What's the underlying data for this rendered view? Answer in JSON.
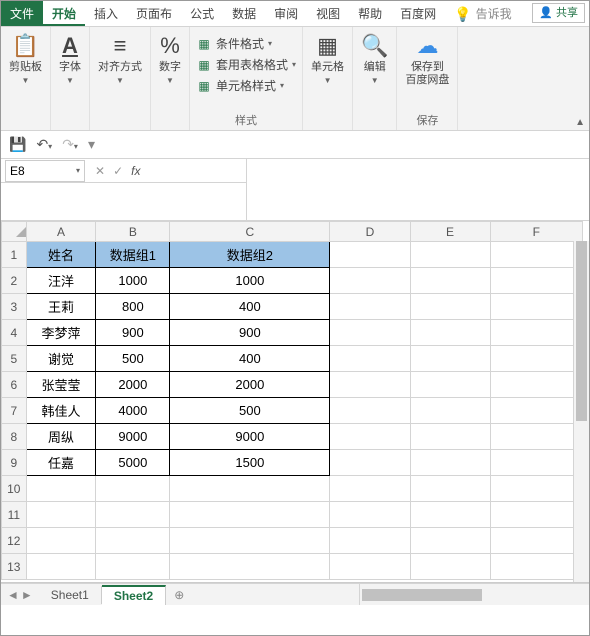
{
  "tabs": {
    "file": "文件",
    "home": "开始",
    "insert": "插入",
    "layout": "页面布",
    "formulas": "公式",
    "data": "数据",
    "review": "审阅",
    "view": "视图",
    "help": "帮助",
    "baidu": "百度网",
    "tell": "告诉我",
    "share": "共享"
  },
  "ribbon": {
    "clipboard": "剪贴板",
    "font": "字体",
    "align": "对齐方式",
    "number": "数字",
    "cond_fmt": "条件格式",
    "table_fmt": "套用表格格式",
    "cell_style": "单元格样式",
    "styles": "样式",
    "cells": "单元格",
    "editing": "编辑",
    "save_baidu": "保存到\n百度网盘",
    "save": "保存"
  },
  "namebox": "E8",
  "columns": [
    "A",
    "B",
    "C",
    "D",
    "E",
    "F"
  ],
  "row_numbers": [
    "1",
    "2",
    "3",
    "4",
    "5",
    "6",
    "7",
    "8",
    "9",
    "10",
    "11",
    "12",
    "13"
  ],
  "chart_data": {
    "type": "table",
    "headers": [
      "姓名",
      "数据组1",
      "数据组2"
    ],
    "rows": [
      [
        "汪洋",
        "1000",
        "1000"
      ],
      [
        "王莉",
        "800",
        "400"
      ],
      [
        "李梦萍",
        "900",
        "900"
      ],
      [
        "谢觉",
        "500",
        "400"
      ],
      [
        "张莹莹",
        "2000",
        "2000"
      ],
      [
        "韩佳人",
        "4000",
        "500"
      ],
      [
        "周纵",
        "9000",
        "9000"
      ],
      [
        "任嘉",
        "5000",
        "1500"
      ]
    ]
  },
  "sheets": {
    "s1": "Sheet1",
    "s2": "Sheet2"
  }
}
